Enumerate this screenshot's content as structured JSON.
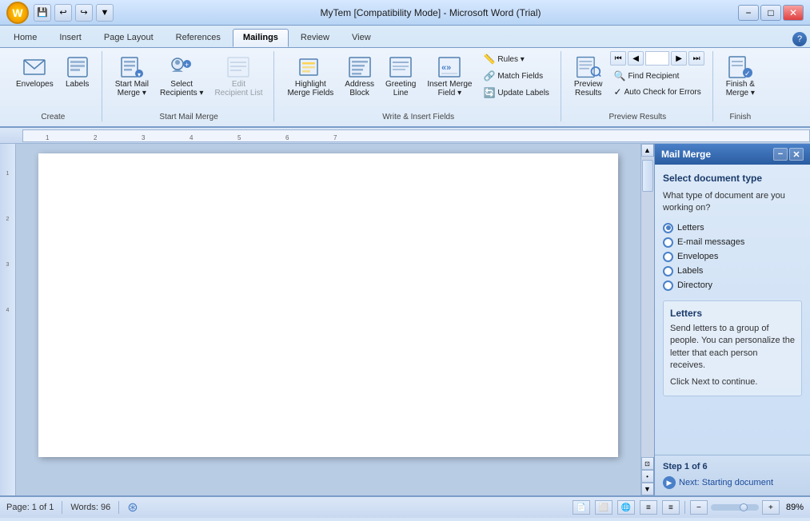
{
  "titlebar": {
    "title": "MyTem [Compatibility Mode] - Microsoft Word (Trial)",
    "minimize": "−",
    "maximize": "□",
    "close": "✕"
  },
  "quickaccess": {
    "save": "💾",
    "undo": "↩",
    "redo": "↪",
    "dropdown": "▼"
  },
  "tabs": [
    {
      "label": "Home",
      "active": false
    },
    {
      "label": "Insert",
      "active": false
    },
    {
      "label": "Page Layout",
      "active": false
    },
    {
      "label": "References",
      "active": false
    },
    {
      "label": "Mailings",
      "active": true
    },
    {
      "label": "Review",
      "active": false
    },
    {
      "label": "View",
      "active": false
    }
  ],
  "ribbon": {
    "groups": [
      {
        "id": "create",
        "label": "Create",
        "buttons": [
          {
            "id": "envelopes",
            "icon": "✉",
            "label": "Envelopes"
          },
          {
            "id": "labels",
            "icon": "🏷",
            "label": "Labels"
          }
        ]
      },
      {
        "id": "start-mail-merge",
        "label": "Start Mail Merge",
        "buttons": [
          {
            "id": "start-mail-merge-btn",
            "icon": "📋",
            "label": "Start Mail\nMerge ▾"
          },
          {
            "id": "select-recipients",
            "icon": "👥",
            "label": "Select\nRecipients ▾"
          },
          {
            "id": "edit-recipient-list",
            "icon": "📝",
            "label": "Edit\nRecipient List",
            "disabled": true
          }
        ]
      },
      {
        "id": "write-insert",
        "label": "Write & Insert Fields",
        "buttons": [
          {
            "id": "highlight-merge",
            "icon": "🖊",
            "label": "Highlight\nMerge Fields"
          },
          {
            "id": "address-block",
            "icon": "📮",
            "label": "Address\nBlock"
          },
          {
            "id": "greeting-line",
            "icon": "👋",
            "label": "Greeting\nLine"
          },
          {
            "id": "insert-merge",
            "icon": "«»",
            "label": "Insert Merge\nField ▾"
          }
        ],
        "smallButtons": [
          {
            "id": "rules",
            "icon": "📏",
            "label": "Rules ▾"
          },
          {
            "id": "match-fields",
            "icon": "🔗",
            "label": "Match Fields"
          },
          {
            "id": "update-labels",
            "icon": "🔄",
            "label": "Update Labels"
          }
        ]
      },
      {
        "id": "preview-results-group",
        "label": "Preview Results",
        "previewBtn": {
          "id": "preview-results",
          "icon": "👁",
          "label": "Preview\nResults"
        },
        "navBtns": [
          "⏮",
          "◀",
          "",
          "▶",
          "⏭"
        ],
        "smallButtons": [
          {
            "id": "find-recipient",
            "icon": "🔍",
            "label": "Find Recipient"
          },
          {
            "id": "auto-check",
            "icon": "✓",
            "label": "Auto Check for Errors"
          }
        ]
      },
      {
        "id": "finish",
        "label": "Finish",
        "buttons": [
          {
            "id": "finish-merge",
            "icon": "✅",
            "label": "Finish &\nMerge ▾"
          }
        ]
      }
    ]
  },
  "mailMerge": {
    "title": "Mail Merge",
    "sectionTitle": "Select document type",
    "question": "What type of document are you working on?",
    "options": [
      {
        "id": "letters",
        "label": "Letters",
        "selected": true
      },
      {
        "id": "email-messages",
        "label": "E-mail messages",
        "selected": false
      },
      {
        "id": "envelopes",
        "label": "Envelopes",
        "selected": false
      },
      {
        "id": "labels",
        "label": "Labels",
        "selected": false
      },
      {
        "id": "directory",
        "label": "Directory",
        "selected": false
      }
    ],
    "descriptionTitle": "Letters",
    "descriptionText": "Send letters to a group of people. You can personalize the letter that each person receives.",
    "continueText": "Click Next to continue.",
    "step": "Step 1 of 6",
    "nextLabel": "Next: Starting document"
  },
  "statusBar": {
    "page": "Page: 1 of 1",
    "words": "Words: 96",
    "zoom": "89%"
  }
}
